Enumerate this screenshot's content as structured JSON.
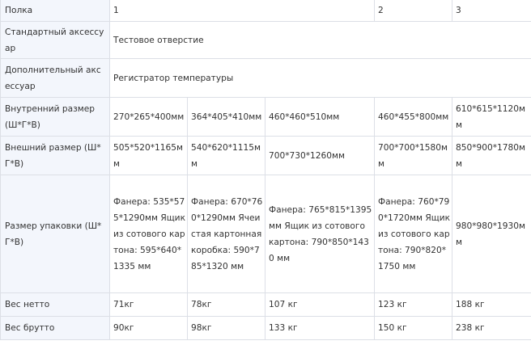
{
  "rows": [
    {
      "label": "Полка",
      "cells": [
        "1",
        "2",
        "3"
      ]
    },
    {
      "label": "Стандартный аксессуар",
      "cells": [
        "Тестовое отверстие"
      ]
    },
    {
      "label": "Дополнительный аксессуар",
      "cells": [
        "Регистратор температуры"
      ]
    },
    {
      "label": "Внутренний размер (Ш*Г*В)",
      "cells": [
        "270*265*400мм",
        "364*405*410мм",
        "460*460*510мм",
        "460*455*800мм",
        "610*615*1120мм"
      ]
    },
    {
      "label": "Внешний размер (Ш*Г*В)",
      "cells": [
        "505*520*1165мм",
        "540*620*1115мм",
        "700*730*1260мм",
        "700*700*1580мм",
        "850*900*1780мм"
      ]
    },
    {
      "label": "Размер упаковки (Ш*Г*В)",
      "cells": [
        "Фанера: 535*575*1290мм Ящик из сотового картона: 595*640*1335 мм",
        "Фанера: 670*760*1290мм Ячеистая картонная коробка: 590*785*1320 мм",
        "Фанера: 765*815*1395мм Ящик из сотового картона: 790*850*1430 мм",
        "Фанера: 760*790*1720мм Ящик из сотового картона: 790*820*1750 мм",
        "980*980*1930мм"
      ]
    },
    {
      "label": "Вес нетто",
      "cells": [
        "71кг",
        "78кг",
        "107 кг",
        "123 кг",
        "188 кг"
      ]
    },
    {
      "label": "Вес брутто",
      "cells": [
        "90кг",
        "98кг",
        "133 кг",
        "150 кг",
        "238 кг"
      ]
    }
  ]
}
